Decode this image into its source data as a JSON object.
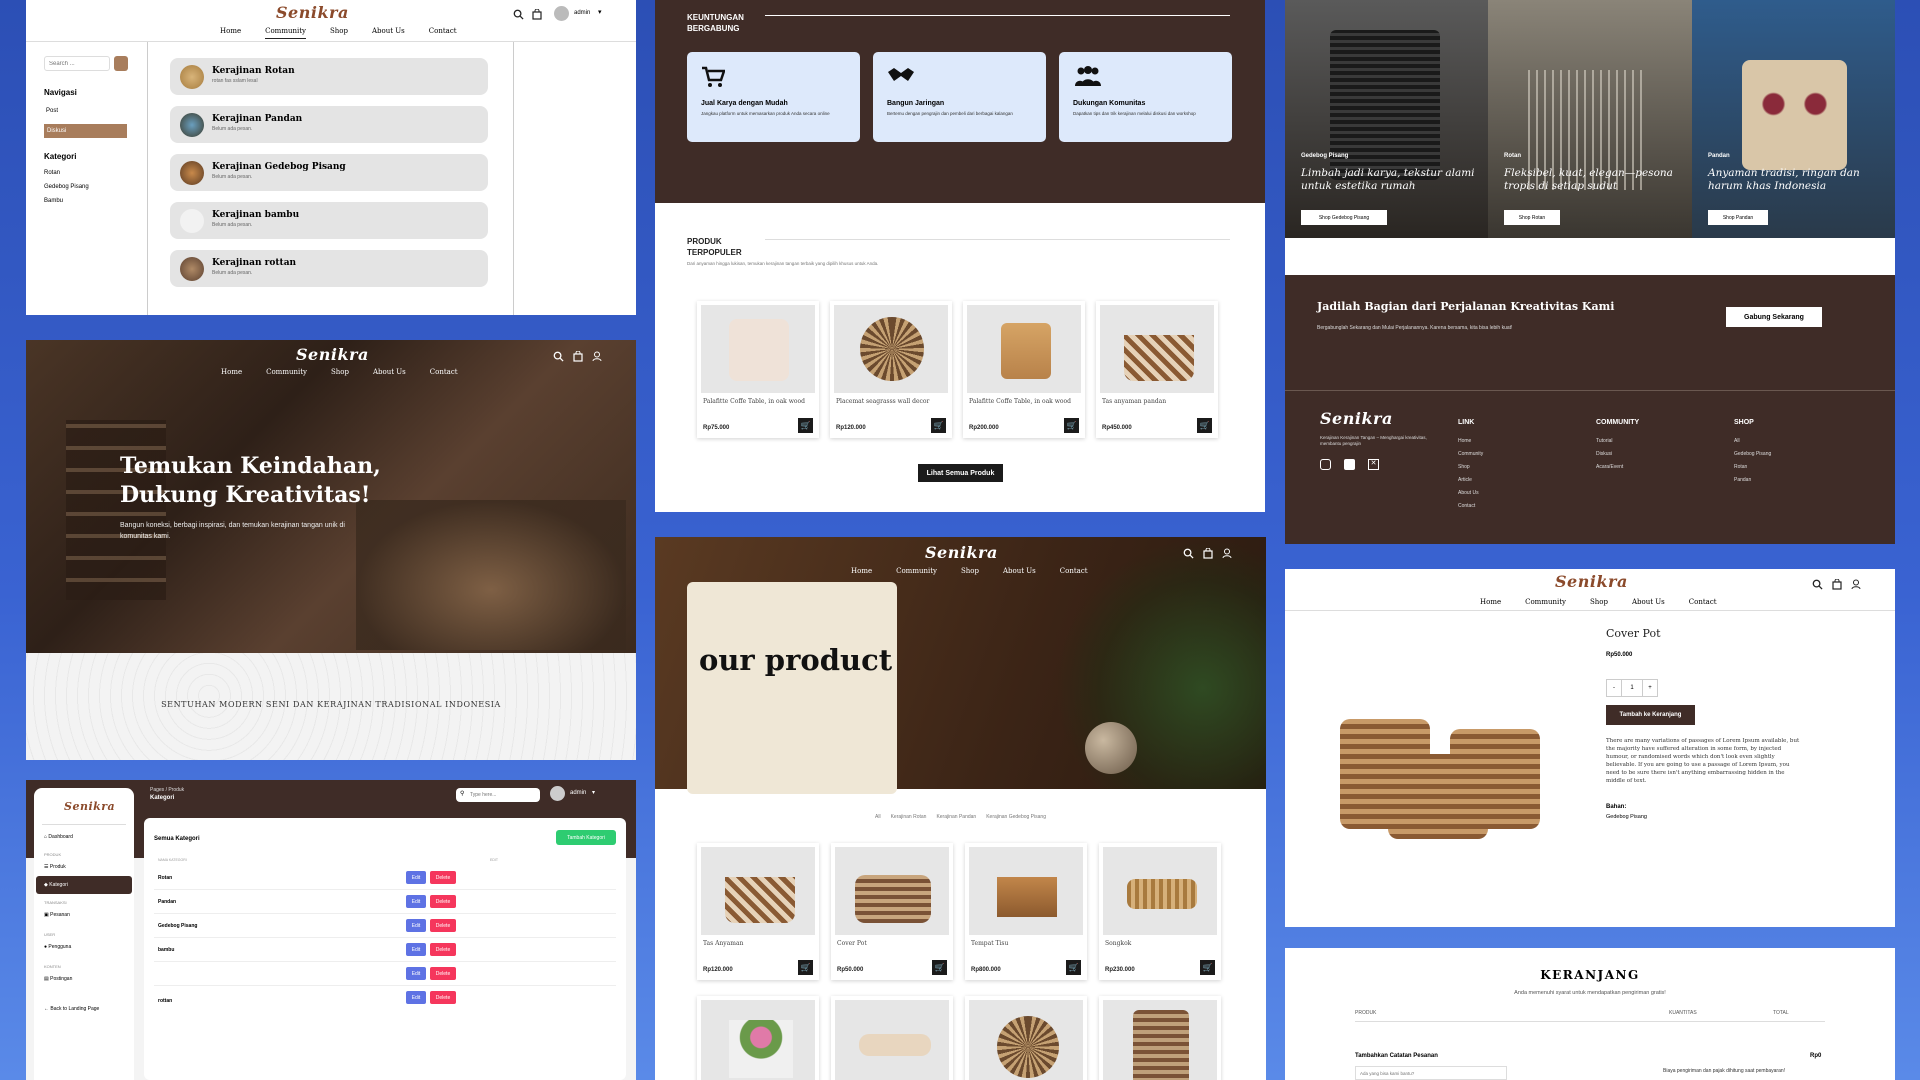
{
  "p1": {
    "logo": "Senikra",
    "nav": [
      "Home",
      "Community",
      "Shop",
      "About Us",
      "Contact"
    ],
    "active": "Community",
    "user": "admin",
    "search_ph": "Search ...",
    "nav_title": "Navigasi",
    "nav_items": [
      "Post",
      "Diskusi"
    ],
    "cat_title": "Kategori",
    "cats": [
      "Rotan",
      "Gedebog Pisang",
      "Bambu"
    ],
    "posts": [
      {
        "t": "Kerajinan Rotan",
        "s": "rotan  fas sslam lesal"
      },
      {
        "t": "Kerajinan Pandan",
        "s": "Belum ada pesan."
      },
      {
        "t": "Kerajinan Gedebog Pisang",
        "s": "Belum ada pesan."
      },
      {
        "t": "Kerajinan bambu",
        "s": "Belum ada pesan."
      },
      {
        "t": "Kerajinan rottan",
        "s": "Belum ada pesan."
      }
    ]
  },
  "p2": {
    "logo": "Senikra",
    "nav": [
      "Home",
      "Community",
      "Shop",
      "About Us",
      "Contact"
    ],
    "h1a": "Temukan Keindahan,",
    "h1b": "Dukung Kreativitas!",
    "sub": "Bangun koneksi, berbagi inspirasi, dan temukan kerajinan tangan unik di komunitas kami.",
    "band": "SENTUHAN MODERN SENI DAN KERAJINAN TRADISIONAL INDONESIA"
  },
  "p3": {
    "logo": "Senikra",
    "crumb": "Pages  /  Produk",
    "crumb2": "Kategori",
    "search_ph": "Type here...",
    "user": "admin",
    "menu": [
      {
        "h": "",
        "items": [
          "Dashboard"
        ]
      },
      {
        "h": "PRODUK",
        "items": [
          "Produk",
          "Kategori"
        ]
      },
      {
        "h": "TRANSAKSI",
        "items": [
          "Pesanan"
        ]
      },
      {
        "h": "USER",
        "items": [
          "Pengguna"
        ]
      },
      {
        "h": "KONTEN",
        "items": [
          "Postingan"
        ]
      }
    ],
    "back": "Back to Landing Page",
    "card_title": "Semua Kategori",
    "add": "Tambah Kategori",
    "col1": "NAMA KATEGORI",
    "col2": "EDIT",
    "rows": [
      "Rotan",
      "Pandan",
      "Gedebog Pisang",
      "bambu",
      "",
      "rottan"
    ],
    "edit": "Edit",
    "del": "Delete"
  },
  "p4": {
    "title1": "KEUNTUNGAN",
    "title2": "BERGABUNG",
    "cards": [
      {
        "t": "Jual Karya dengan Mudah",
        "d": "Jangkau platform untuk memasarkan produk Anda secara online"
      },
      {
        "t": "Bangun Jaringan",
        "d": "Bertemu dengan pengrajin dan pembeli dari berbagai kalangan"
      },
      {
        "t": "Dukungan Komunitas",
        "d": "Dapatkan tips dan trik kerajinan melalui diskusi dan workshop"
      }
    ],
    "pop1": "PRODUK",
    "pop2": "TERPOPULER",
    "pop_sub": "Dari anyaman hingga lukisan, temukan kerajinan tangan terbaik yang dipilih khusus untuk Anda.",
    "products": [
      {
        "n": "Palafitte Coffe Table, in oak wood",
        "p": "Rp75.000"
      },
      {
        "n": "Placemat seagrasss wall decor",
        "p": "Rp120.000"
      },
      {
        "n": "Palafitte Coffe Table, in oak wood",
        "p": "Rp200.000"
      },
      {
        "n": "Tas anyaman pandan",
        "p": "Rp450.000"
      }
    ],
    "see_all": "Lihat Semua Produk"
  },
  "p5": {
    "logo": "Senikra",
    "nav": [
      "Home",
      "Community",
      "Shop",
      "About Us",
      "Contact"
    ],
    "hero": "our product",
    "filters": [
      "All",
      "Kerajinan Rotan",
      "Kerajinan Pandan",
      "Kerajinan Gedebog Pisang"
    ],
    "products": [
      {
        "n": "Tas Anyaman",
        "p": "Rp120.000"
      },
      {
        "n": "Cover Pot",
        "p": "Rp50.000"
      },
      {
        "n": "Tempat Tisu",
        "p": "Rp800.000"
      },
      {
        "n": "Songkok",
        "p": "Rp230.000"
      }
    ]
  },
  "p6": {
    "cols": [
      {
        "tag": "Gedebog Pisang",
        "t": "Limbah jadi karya, tekstur alami untuk estetika rumah",
        "b": "Shop Gedebog Pisang"
      },
      {
        "tag": "Rotan",
        "t": "Fleksibel, kuat, elegan—pesona tropis di setiap sudut",
        "b": "Shop Rotan"
      },
      {
        "tag": "Pandan",
        "t": "Anyaman tradisi, ringan dan harum khas Indonesia",
        "b": "Shop Pandan"
      }
    ],
    "cta": "Jadilah Bagian dari Perjalanan Kreativitas Kami",
    "cta_sub": "Bergabunglah Sekarang dan Mulai Perjalanannya. Karena bersama, kita bisa lebih kuat!",
    "cta_btn": "Gabung Sekarang",
    "logo": "Senikra",
    "about": "Kerajinan Kerajinan Tangan – Menghargai kreativitas, membantu pengrajin",
    "link_h": "LINK",
    "links": [
      "Home",
      "Community",
      "Shop",
      "Article",
      "About Us",
      "Contact"
    ],
    "comm_h": "COMMUNITY",
    "comm": [
      "Tutorial",
      "Diskusi",
      "Acara/Event"
    ],
    "shop_h": "SHOP",
    "shop": [
      "All",
      "Gedebog Pisang",
      "Rotan",
      "Pandan"
    ]
  },
  "p7": {
    "logo": "Senikra",
    "nav": [
      "Home",
      "Community",
      "Shop",
      "About Us",
      "Contact"
    ],
    "title": "Cover Pot",
    "price": "Rp50.000",
    "qty": "1",
    "minus": "-",
    "plus": "+",
    "add": "Tambah ke Keranjang",
    "desc": "There are many variations of passages of Lorem Ipsum available, but the majority have suffered alteration in some form, by injected humour, or randomised words which don't look even slightly believable. If you are going to use a passage of Lorem Ipsum, you need to be sure there isn't anything embarrassing hidden in the middle of text.",
    "bahan_h": "Bahan:",
    "bahan": "Gedebog Pisang"
  },
  "p8": {
    "title": "KERANJANG",
    "sub": "Anda memenuhi syarat untuk mendapatkan pengiriman gratis!",
    "cols": [
      "PRODUK",
      "KUANTITAS",
      "TOTAL"
    ],
    "note_h": "Tambahkan Catatan Pesanan",
    "note_ph": "Ada yang bisa kami bantu?",
    "total": "Rp0",
    "ship": "Biaya pengiriman dan pajak dihitung saat pembayaran!"
  },
  "colors": {
    "brown": "#3f2c27",
    "accent": "#a87d5c",
    "blue_card": "#dde9fb"
  }
}
